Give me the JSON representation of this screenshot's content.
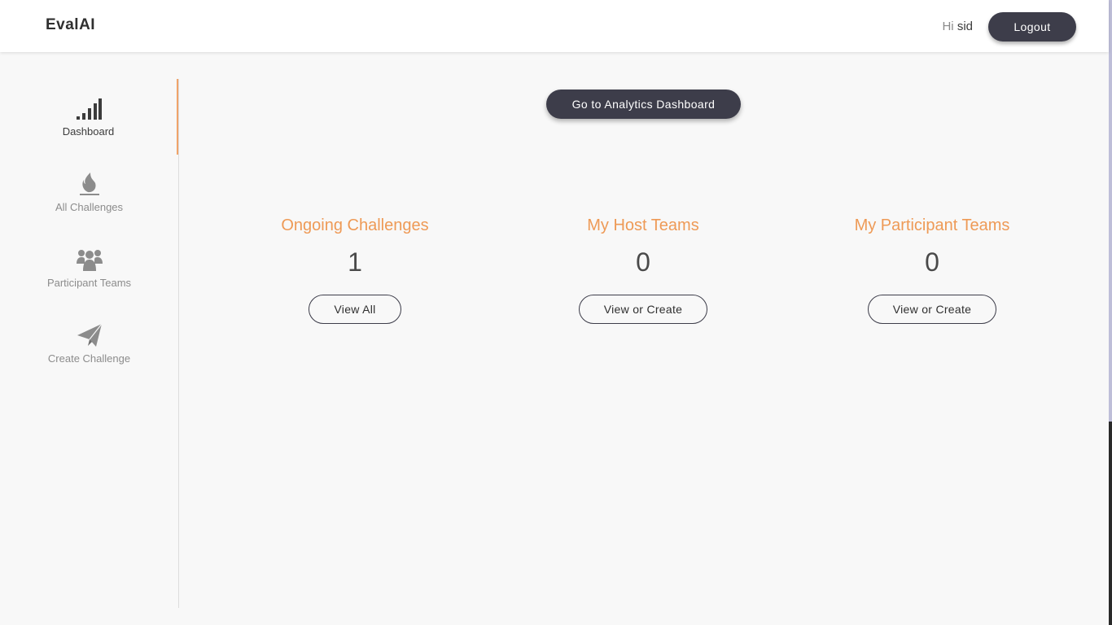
{
  "header": {
    "logo": "EvalAI",
    "greeting_prefix": "Hi",
    "username": "sid",
    "logout_label": "Logout"
  },
  "sidebar": {
    "items": [
      {
        "label": "Dashboard",
        "icon": "signal-bars-icon",
        "active": true
      },
      {
        "label": "All Challenges",
        "icon": "flame-icon",
        "active": false
      },
      {
        "label": "Participant Teams",
        "icon": "users-group-icon",
        "active": false
      },
      {
        "label": "Create Challenge",
        "icon": "paper-plane-icon",
        "active": false
      }
    ]
  },
  "main": {
    "analytics_button": "Go to Analytics Dashboard",
    "stats": [
      {
        "title": "Ongoing Challenges",
        "count": "1",
        "button": "View All"
      },
      {
        "title": "My Host Teams",
        "count": "0",
        "button": "View or Create"
      },
      {
        "title": "My Participant Teams",
        "count": "0",
        "button": "View or Create"
      }
    ]
  },
  "colors": {
    "accent_orange": "#ee9a56",
    "dark_button": "#3d3d4a",
    "background": "#f8f8f8"
  }
}
